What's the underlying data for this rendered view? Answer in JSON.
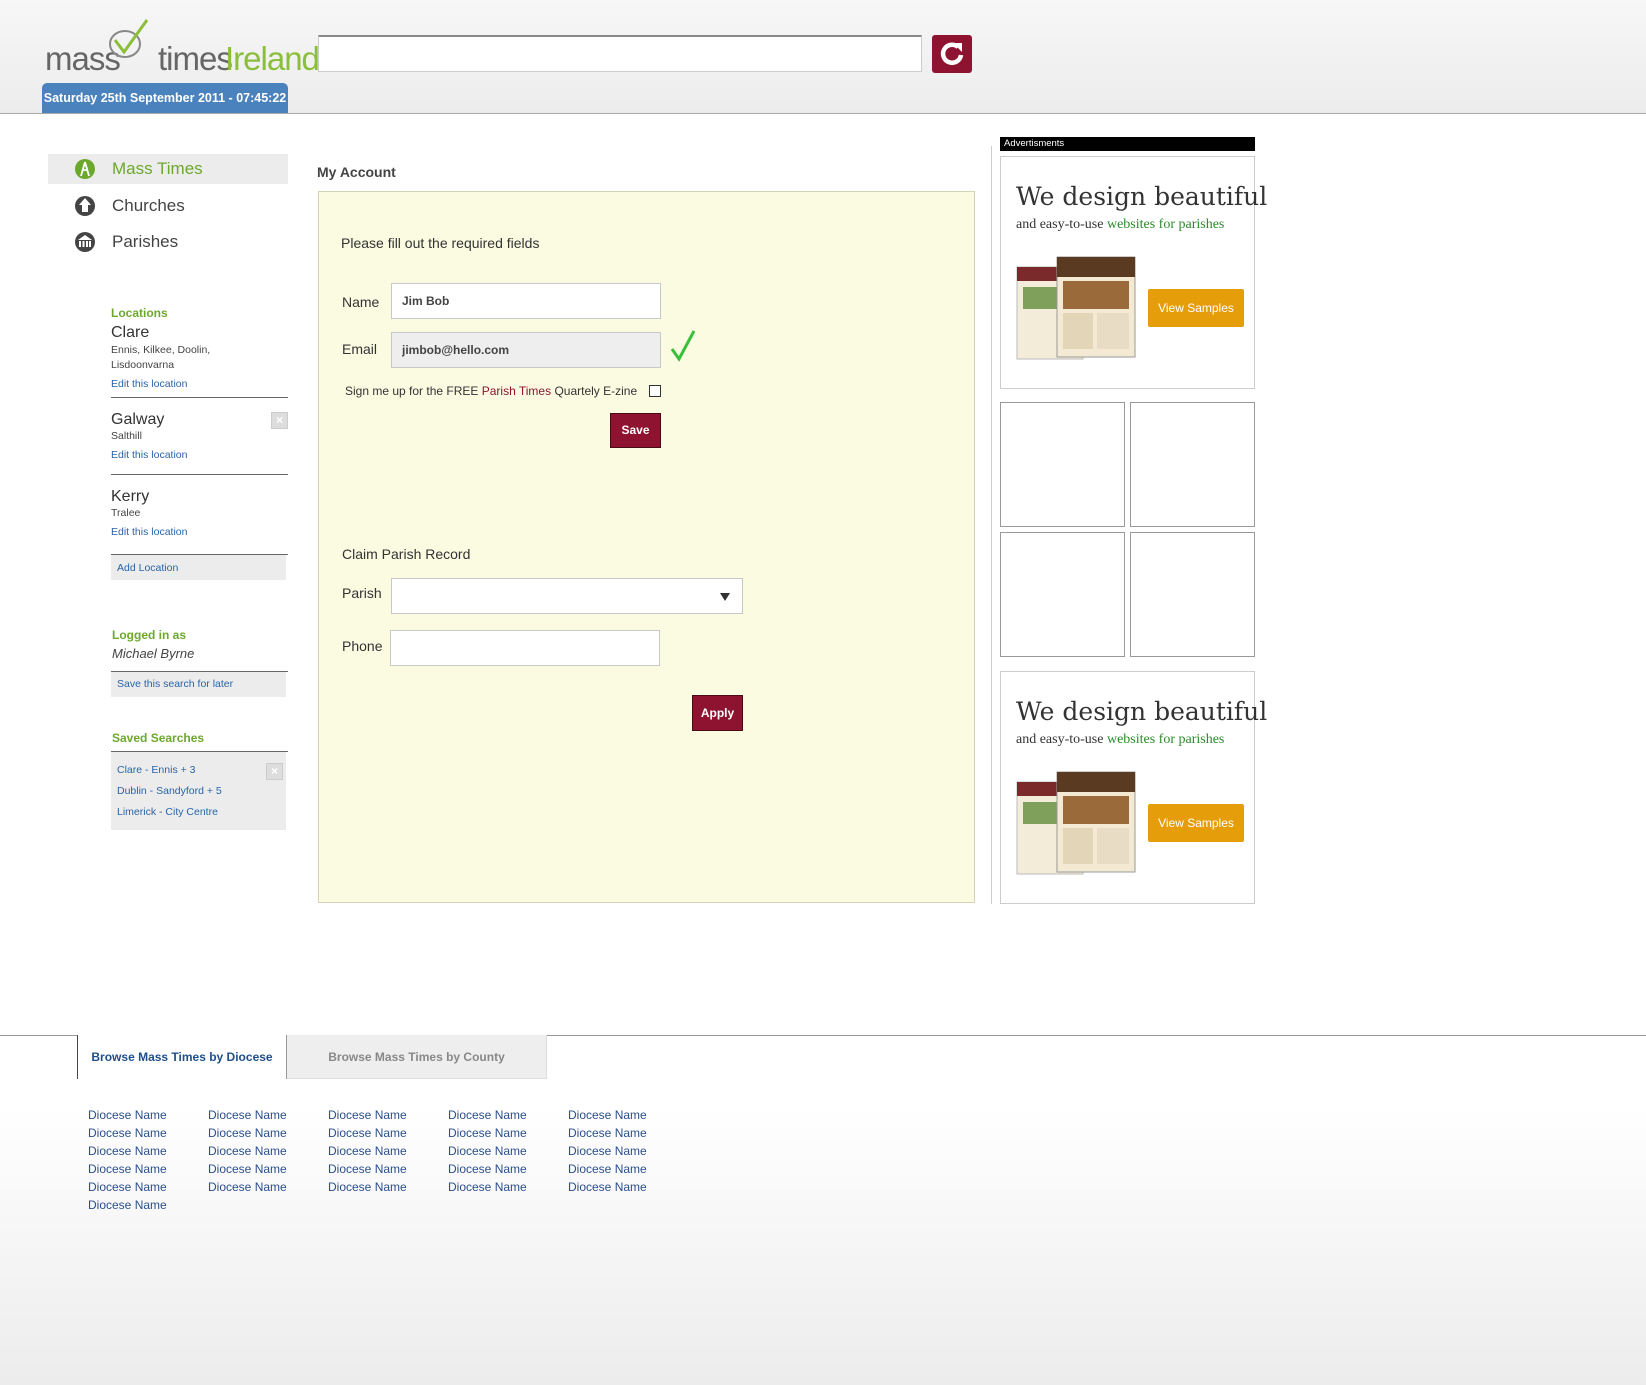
{
  "header": {
    "logo": {
      "part1": "mass",
      "part2": "times",
      "part3": "Ireland"
    },
    "datetime": "Saturday 25th September 2011 - 07:45:22",
    "search": {
      "value": "",
      "placeholder": ""
    }
  },
  "nav": {
    "items": [
      {
        "label": "Mass Times",
        "icon": "mass-times-icon"
      },
      {
        "label": "Churches",
        "icon": "church-icon"
      },
      {
        "label": "Parishes",
        "icon": "parish-icon"
      }
    ]
  },
  "sidebar": {
    "locations_heading": "Locations",
    "locations": [
      {
        "name": "Clare",
        "sub": "Ennis, Kilkee, Doolin, Lisdoonvarna",
        "edit": "Edit this location"
      },
      {
        "name": "Galway",
        "sub": "Salthill",
        "edit": "Edit this location"
      },
      {
        "name": "Kerry",
        "sub": "Tralee",
        "edit": "Edit this location"
      }
    ],
    "add_location": "Add Location",
    "logged_in_heading": "Logged in as",
    "user_name": "Michael Byrne",
    "save_search": "Save this search for later",
    "saved_heading": "Saved Searches",
    "saved_searches": [
      "Clare - Ennis + 3",
      "Dublin - Sandyford + 5",
      "Limerick - City Centre"
    ]
  },
  "main": {
    "title": "My Account",
    "form": {
      "instruction": "Please fill out the required fields",
      "name_label": "Name",
      "name_value": "Jim Bob",
      "email_label": "Email",
      "email_value": "jimbob@hello.com",
      "newsletter_pre": "Sign me up for the FREE",
      "newsletter_brand": "Parish Times",
      "newsletter_post": "Quartely E-zine",
      "save_label": "Save"
    },
    "claim": {
      "heading": "Claim Parish Record",
      "parish_label": "Parish",
      "parish_value": "",
      "phone_label": "Phone",
      "phone_value": "",
      "apply_label": "Apply"
    }
  },
  "ads": {
    "header": "Advertisments",
    "promo": {
      "title": "We design beautiful",
      "sub_pre": "and easy-to-use",
      "sub_green": "websites for parishes",
      "button": "View Samples"
    }
  },
  "footer": {
    "tabs": [
      "Browse Mass Times by Diocese",
      "Browse Mass Times by County"
    ],
    "columns": [
      [
        "Diocese Name",
        "Diocese Name",
        "Diocese Name",
        "Diocese Name",
        "Diocese Name",
        "Diocese Name"
      ],
      [
        "Diocese Name",
        "Diocese Name",
        "Diocese Name",
        "Diocese Name",
        "Diocese Name"
      ],
      [
        "Diocese Name",
        "Diocese Name",
        "Diocese Name",
        "Diocese Name",
        "Diocese Name"
      ],
      [
        "Diocese Name",
        "Diocese Name",
        "Diocese Name",
        "Diocese Name",
        "Diocese Name"
      ],
      [
        "Diocese Name",
        "Diocese Name",
        "Diocese Name",
        "Diocese Name",
        "Diocese Name"
      ]
    ]
  },
  "colors": {
    "brand_green": "#6da82e",
    "brand_red": "#8e1330",
    "date_blue": "#4a82bd",
    "link_blue": "#2a64a8",
    "form_bg": "#fbfbe1",
    "ad_orange": "#e69d0a"
  }
}
